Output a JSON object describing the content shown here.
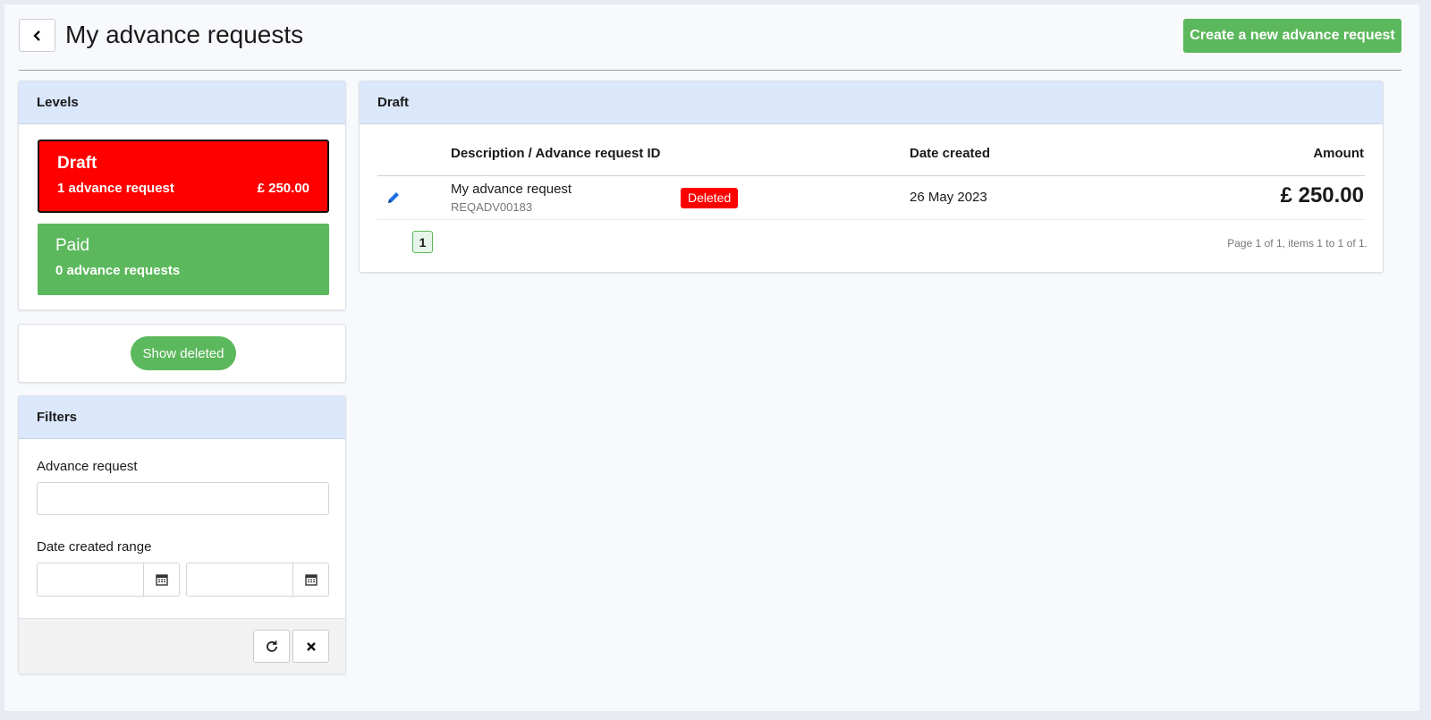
{
  "header": {
    "title": "My advance requests",
    "create_label": "Create a new advance request"
  },
  "levels": {
    "title": "Levels",
    "items": [
      {
        "name": "Draft",
        "count": "1 advance request",
        "amount": "£ 250.00"
      },
      {
        "name": "Paid",
        "count": "0 advance requests",
        "amount": ""
      }
    ]
  },
  "show_deleted_label": "Show deleted",
  "filters": {
    "title": "Filters",
    "advance_label": "Advance request",
    "advance_value": "",
    "date_label": "Date created range",
    "date_from": "",
    "date_to": ""
  },
  "table": {
    "title": "Draft",
    "columns": [
      "Description / Advance request ID",
      "Date created",
      "Amount"
    ],
    "rows": [
      {
        "description": "My advance request",
        "id": "REQADV00183",
        "badge": "Deleted",
        "date": "26 May 2023",
        "amount": "£ 250.00"
      }
    ],
    "page": "1",
    "page_info": "Page 1 of 1, items 1 to 1 of 1."
  },
  "colors": {
    "green": "#5cb85c",
    "red": "#ff0000",
    "header_blue": "#dbe7fb"
  },
  "icons": [
    "chevron-left-icon",
    "pencil-icon",
    "calendar-icon",
    "refresh-icon",
    "close-icon"
  ]
}
